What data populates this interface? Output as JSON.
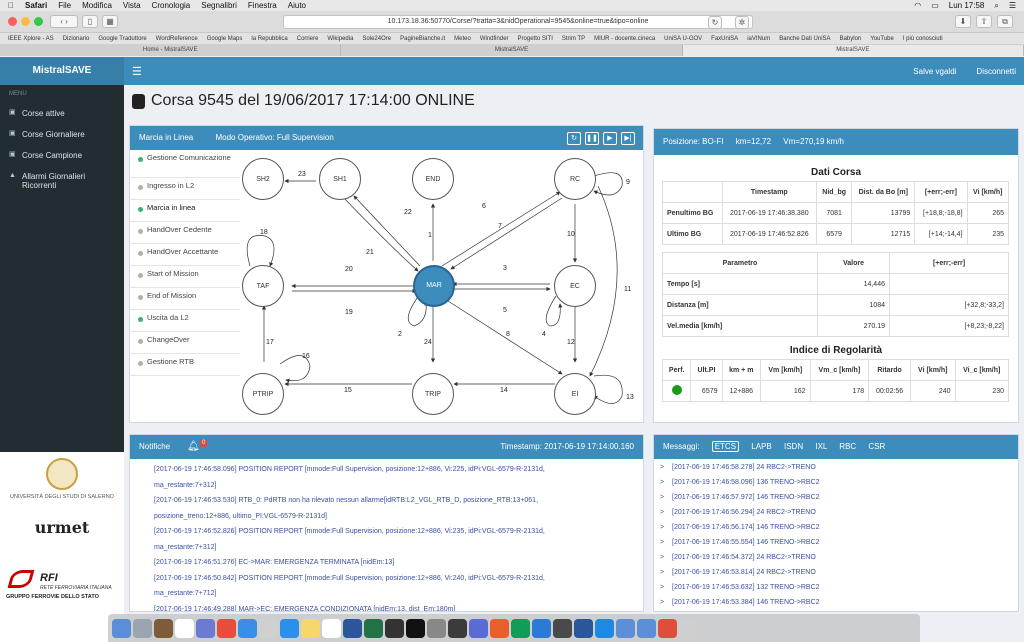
{
  "macbar": {
    "apple": "",
    "app": "Safari",
    "menus": [
      "File",
      "Modifica",
      "Vista",
      "Cronologia",
      "Segnalibri",
      "Finestra",
      "Aiuto"
    ],
    "clock": "Lun 17:58"
  },
  "browser": {
    "url": "10.173.18.36:50770/Corse/?tratta=3&nidOperational=9545&online=true&tipo=online",
    "bookmarks": [
      "IEEE Xplore - AS",
      "Dizionario",
      "Google Traduttore",
      "WordReference",
      "Google Maps",
      "la Repubblica",
      "Corriere",
      "Wikipedia",
      "Sole24Ore",
      "PagineBianche.it",
      "Meteo",
      "Windfinder",
      "Progetto SITI",
      "Strim TP",
      "MIUR - docente.cineca",
      "UniSA U-GOV",
      "FaxUniSA",
      "iaVINum",
      "Banche Dati UniSA",
      "Babylon",
      "YouTube",
      "I più conosciuti"
    ],
    "tabs": [
      "Home - MistralSAVE",
      "MistralSAVE",
      "MistralSAVE"
    ]
  },
  "sidebar": {
    "logo": "MistralSAVE",
    "menu_label": "MENU",
    "items": [
      "Corse attive",
      "Corse Giornaliere",
      "Corse Campione",
      "Allarmi Giornalieri Ricorrenti"
    ],
    "logos": {
      "unisa": "UNIVERSITÀ DEGLI STUDI DI SALERNO",
      "urmet": "urmet",
      "rfi1": "RFI",
      "rfi2": "RETE FERROVIARIA ITALIANA",
      "rfi3": "GRUPPO FERROVIE DELLO STATO"
    }
  },
  "header": {
    "save": "Salve vgaldi",
    "logout": "Disconnetti"
  },
  "title": "Corsa 9545 del 19/06/2017 17:14:00 ONLINE",
  "graph_panel": {
    "title": "Marcia in Linea",
    "mode": "Modo Operativo: Full Supervision",
    "menu": [
      {
        "label": "Gestione Comunicazione",
        "color": "#3cb371"
      },
      {
        "label": "Ingresso in L2",
        "color": "#b0b0b0"
      },
      {
        "label": "Marcia in linea",
        "color": "#3cb371"
      },
      {
        "label": "HandOver Cedente",
        "color": "#b0b0b0"
      },
      {
        "label": "HandOver Accettante",
        "color": "#b0b0b0"
      },
      {
        "label": "Start of Mission",
        "color": "#b0b0b0"
      },
      {
        "label": "End of Mission",
        "color": "#b0b0b0"
      },
      {
        "label": "Uscita da L2",
        "color": "#3cb371"
      },
      {
        "label": "ChangeOver",
        "color": "#b0b0b0"
      },
      {
        "label": "Gestione RTB",
        "color": "#b0b0b0"
      }
    ],
    "nodes": [
      "SH2",
      "SH1",
      "END",
      "RC",
      "TAF",
      "MAR",
      "EC",
      "PTRIP",
      "TRIP",
      "EI"
    ],
    "edge_labels": [
      "23",
      "22",
      "1",
      "6",
      "7",
      "9",
      "21",
      "20",
      "19",
      "3",
      "5",
      "10",
      "11",
      "18",
      "2",
      "4",
      "12",
      "24",
      "8",
      "17",
      "16",
      "15",
      "14",
      "13"
    ]
  },
  "position": {
    "label": "Posizione: BO-FI",
    "km": "km=12,72",
    "vm": "Vm=270,19 km/h"
  },
  "dati_corsa": {
    "title": "Dati Corsa",
    "headers": [
      "",
      "Timestamp",
      "Nid_bg",
      "Dist. da Bo [m]",
      "[+err;-err]",
      "Vi [km/h]"
    ],
    "rows": [
      [
        "Penultimo BG",
        "2017-06-19 17:46:38.380",
        "7081",
        "13799",
        "[+18,8;-18,8]",
        "265"
      ],
      [
        "Ultimo BG",
        "2017-06-19 17:46:52.826",
        "6579",
        "12715",
        "[+14;-14,4]",
        "235"
      ]
    ]
  },
  "parametri": {
    "headers": [
      "Parametro",
      "Valore",
      "[+err;-err]"
    ],
    "rows": [
      [
        "Tempo [s]",
        "14,446",
        ""
      ],
      [
        "Distanza [m]",
        "1084",
        "[+32,8;-33,2]"
      ],
      [
        "Vel.media [km/h]",
        "270.19",
        "[+8,23;-8,22]"
      ]
    ]
  },
  "regolarita": {
    "title": "Indice di Regolarità",
    "headers": [
      "Perf.",
      "Ult.PI",
      "km + m",
      "Vm [km/h]",
      "Vm_c [km/h]",
      "Ritardo",
      "Vi [km/h]",
      "Vi_c [km/h]"
    ],
    "row": [
      "",
      "6579",
      "12+886",
      "162",
      "178",
      "00:02:56",
      "240",
      "230"
    ],
    "perf_color": "#1a9a1a"
  },
  "notifiche": {
    "title": "Notifiche",
    "badge": "0",
    "timestamp": "Timestamp: 2017-06-19 17:14:00.160",
    "lines": [
      "[2017-06-19 17:46:58.096] POSITION REPORT [mmode:Full Supervision, posizione:12+886, Vi:225, idPi:VGL-6579-R-2131d,",
      "ma_restante:7+312]",
      "[2017-06-19 17:46:53.530] RTB_0: PdRTB non ha rilevato nessun allarme[idRTB:L2_VGL_RTB_D, posizione_RTB:13+061,",
      "posizione_treno:12+886, ultimo_PI:VGL-6579-R-2131d]",
      "[2017-06-19 17:46:52.826] POSITION REPORT [mmode:Full Supervision, posizione:12+886, Vi:235, idPi:VGL-6579-R-2131d,",
      "ma_restante:7+312]",
      "[2017-06-19 17:46:51.276] EC->MAR: EMERGENZA TERMINATA [nidEm:13]",
      "[2017-06-19 17:46:50.842] POSITION REPORT [mmode:Full Supervision, posizione:12+886, Vi:240, idPi:VGL-6579-R-2131d,",
      "ma_restante:7+712]",
      "[2017-06-19 17:46:49.288] MAR->EC: EMERGENZA CONDIZIONATA [nidEm:13, dist_Em:180m]"
    ]
  },
  "messaggi": {
    "title": "Messaggi:",
    "tabs": [
      "ETCS",
      "LAPB",
      "ISDN",
      "IXL",
      "RBC",
      "CSR"
    ],
    "lines": [
      "[2017-06-19 17:46:58.278] 24 RBC2->TRENO",
      "[2017-06-19 17:46:58.096] 136 TRENO->RBC2",
      "[2017-06-19 17:46:57.972] 146 TRENO->RBC2",
      "[2017-06-19 17:46:56.294] 24 RBC2->TRENO",
      "[2017-06-19 17:46:56.174] 146 TRENO->RBC2",
      "[2017-06-19 17:46:55.554] 146 TRENO->RBC2",
      "[2017-06-19 17:46:54.372] 24 RBC2->TRENO",
      "[2017-06-19 17:46:53.814] 24 RBC2->TRENO",
      "[2017-06-19 17:46:53.632] 132 TRENO->RBC2",
      "[2017-06-19 17:46:53.384] 146 TRENO->RBC2"
    ]
  }
}
